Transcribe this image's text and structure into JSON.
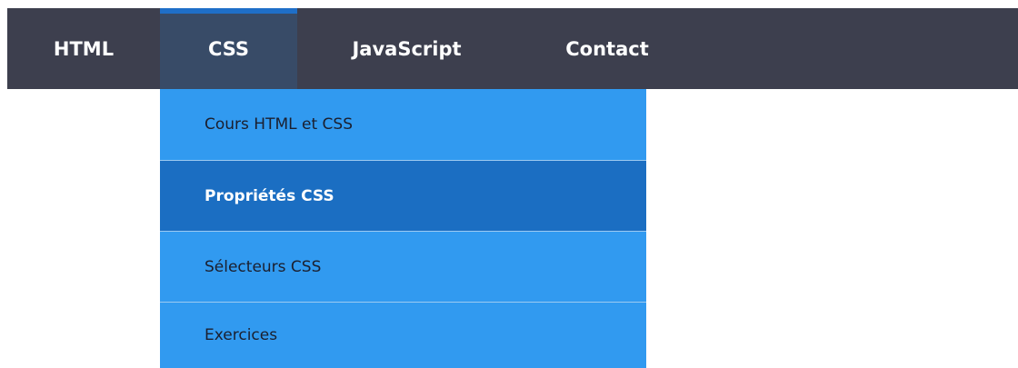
{
  "nav": {
    "items": [
      {
        "label": "HTML"
      },
      {
        "label": "CSS",
        "active": true
      },
      {
        "label": "JavaScript"
      },
      {
        "label": "Contact"
      }
    ]
  },
  "dropdown": {
    "items": [
      {
        "label": "Cours HTML et CSS"
      },
      {
        "label": "Propriétés CSS",
        "active": true
      },
      {
        "label": "Sélecteurs CSS"
      },
      {
        "label": "Exercices"
      }
    ]
  },
  "colors": {
    "navbar": "#3d3f4e",
    "nav_active": "#384b67",
    "nav_active_border": "#1f6fc8",
    "dropdown": "#319af0",
    "dropdown_active": "#1b6ec2"
  }
}
